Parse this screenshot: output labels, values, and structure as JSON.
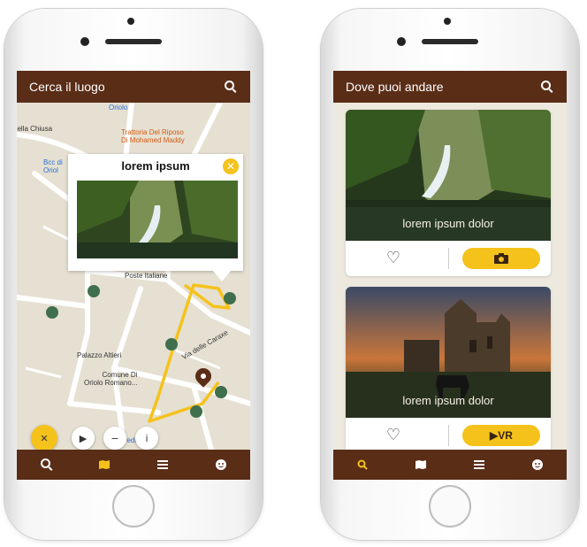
{
  "left_screen": {
    "header": {
      "title": "Cerca il luogo",
      "search_icon": "search-icon"
    },
    "map": {
      "labels": {
        "trattoria": "Trattoria Del Riposo\nDi Mohamed Maddy",
        "oriolo_top": "Oriolo",
        "via_chiusa": "della Chiusa",
        "bcc": "Bcc di\nOriol",
        "poste": "Poste Italiane",
        "palazzo": "Palazzo Altieri",
        "comune": "Comune Di\nOriolo Romano...",
        "via_caraxe": "Via delle Caraxe",
        "unicredit": "UniCredit"
      }
    },
    "popup": {
      "title": "lorem ipsum",
      "close_icon": "close-icon"
    },
    "controls": {
      "close": "✕",
      "play": "▶",
      "minus": "−",
      "info": "i"
    },
    "bottom_nav": [
      "search-icon",
      "map-icon",
      "list-icon",
      "smile-icon"
    ],
    "colors": {
      "brown": "#5a2d17",
      "yellow": "#f5c21b",
      "green": "#3f6f4c"
    }
  },
  "right_screen": {
    "header": {
      "title": "Dove puoi andare",
      "search_icon": "search-icon"
    },
    "cards": [
      {
        "caption": "lorem ipsum dolor",
        "action_icon": "camera-icon",
        "action_label": ""
      },
      {
        "caption": "lorem ipsum dolor",
        "action_icon": "play-icon",
        "action_label": "▶VR"
      }
    ],
    "bottom_nav": [
      "search-icon",
      "map-icon",
      "list-icon",
      "smile-icon"
    ]
  }
}
